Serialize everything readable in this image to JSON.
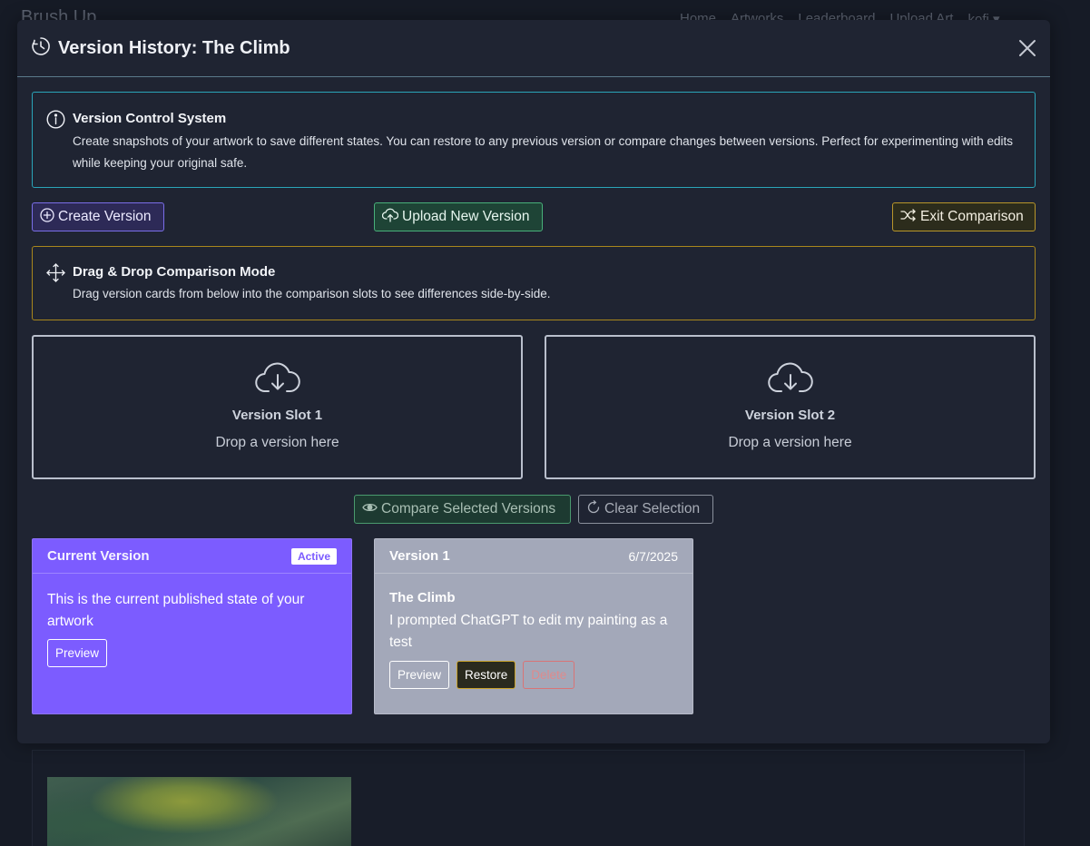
{
  "background": {
    "brand": "Brush Up",
    "nav": [
      "Home",
      "Artworks",
      "Leaderboard",
      "Upload Art",
      "kofi ▾"
    ]
  },
  "modal": {
    "title": "Version History: The Climb",
    "close_icon": "close-icon",
    "title_icon": "history-icon"
  },
  "info": {
    "title": "Version Control System",
    "text": "Create snapshots of your artwork to save different states. You can restore to any previous version or compare changes between versions. Perfect for experimenting with edits while keeping your original safe.",
    "icon": "info-icon"
  },
  "actions": {
    "create_label": "Create Version",
    "upload_label": "Upload New Version",
    "exit_label": "Exit Comparison"
  },
  "drag": {
    "title": "Drag & Drop Comparison Mode",
    "text": "Drag version cards from below into the comparison slots to see differences side-by-side.",
    "icon": "move-icon"
  },
  "slots": [
    {
      "title": "Version Slot 1",
      "hint": "Drop a version here"
    },
    {
      "title": "Version Slot 2",
      "hint": "Drop a version here"
    }
  ],
  "compare": {
    "compare_label": "Compare Selected Versions",
    "clear_label": "Clear Selection"
  },
  "versions": {
    "current": {
      "title": "Current Version",
      "badge": "Active",
      "description": "This is the current published state of your artwork",
      "preview_label": "Preview"
    },
    "v1": {
      "title": "Version 1",
      "date": "6/7/2025",
      "name": "The Climb",
      "description": "I prompted ChatGPT to edit my painting as a test",
      "preview_label": "Preview",
      "restore_label": "Restore",
      "delete_label": "Delete"
    }
  },
  "colors": {
    "accent_purple": "#7c5cff",
    "info_border": "#2aa4b8",
    "warning_border": "#a8861c",
    "success": "#48b07a"
  }
}
